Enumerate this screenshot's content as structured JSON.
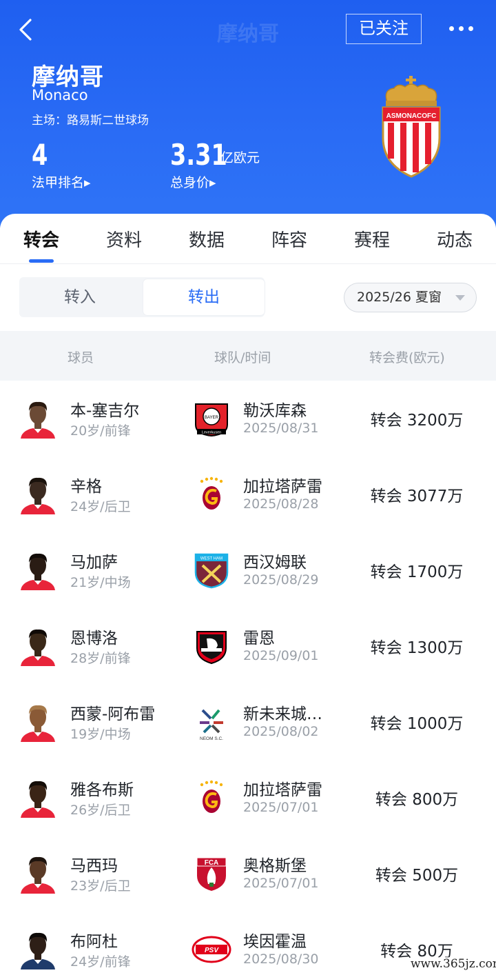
{
  "header": {
    "top_title": "摩纳哥",
    "follow_label": "已关注",
    "team_name": "摩纳哥",
    "team_en": "Monaco",
    "stadium": "主场：路易斯二世球场",
    "rank_value": "4",
    "rank_label": "法甲排名▸",
    "market_value": "3.31",
    "market_unit": "亿欧元",
    "market_label": "总身价▸",
    "crest_text": "ASMONACOFC"
  },
  "tabs": [
    "转会",
    "资料",
    "数据",
    "阵容",
    "赛程",
    "动态"
  ],
  "segment": {
    "in_label": "转入",
    "out_label": "转出"
  },
  "season": "2025/26 夏窗",
  "table_headers": {
    "player": "球员",
    "club_time": "球队/时间",
    "fee": "转会费(欧元)"
  },
  "rows": [
    {
      "name": "本-塞吉尔",
      "meta": "20岁/前锋",
      "club": "勒沃库森",
      "date": "2025/08/31",
      "fee": "转会 3200万",
      "logo": "leverkusen"
    },
    {
      "name": "辛格",
      "meta": "24岁/后卫",
      "club": "加拉塔萨雷",
      "date": "2025/08/28",
      "fee": "转会 3077万",
      "logo": "galatasaray"
    },
    {
      "name": "马加萨",
      "meta": "21岁/中场",
      "club": "西汉姆联",
      "date": "2025/08/29",
      "fee": "转会 1700万",
      "logo": "westham"
    },
    {
      "name": "恩博洛",
      "meta": "28岁/前锋",
      "club": "雷恩",
      "date": "2025/09/01",
      "fee": "转会 1300万",
      "logo": "rennes"
    },
    {
      "name": "西蒙-阿布雷",
      "meta": "19岁/中场",
      "club": "新未来城…",
      "date": "2025/08/02",
      "fee": "转会 1000万",
      "logo": "neom"
    },
    {
      "name": "雅各布斯",
      "meta": "26岁/后卫",
      "club": "加拉塔萨雷",
      "date": "2025/07/01",
      "fee": "转会 800万",
      "logo": "galatasaray"
    },
    {
      "name": "马西玛",
      "meta": "23岁/后卫",
      "club": "奥格斯堡",
      "date": "2025/07/01",
      "fee": "转会 500万",
      "logo": "augsburg"
    },
    {
      "name": "布阿杜",
      "meta": "24岁/前锋",
      "club": "埃因霍温",
      "date": "2025/08/30",
      "fee": "转会 80万",
      "logo": "psv"
    }
  ],
  "logo_text": {
    "leverkusen_top": "BAYER",
    "leverkusen_bottom": "Leverkusen",
    "westham": "WEST HAM",
    "neom": "NEOM S.C.",
    "augsburg": "FCA",
    "psv": "PSV"
  },
  "watermark": "www.365jz.com"
}
